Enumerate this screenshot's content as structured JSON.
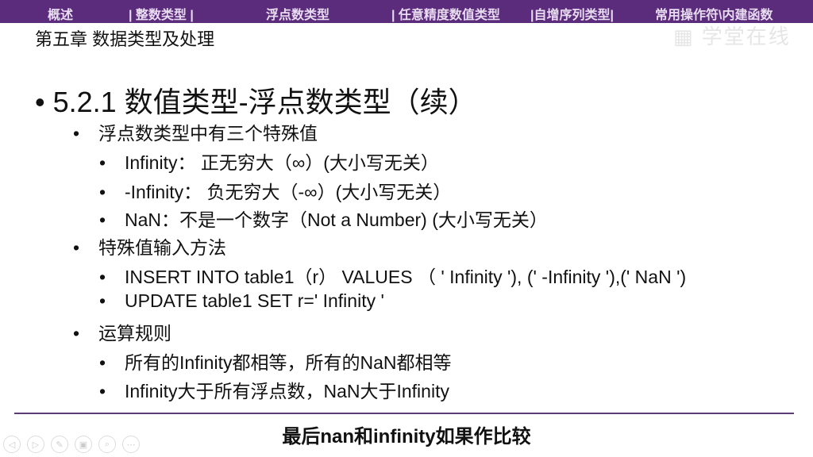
{
  "nav": [
    "概述",
    "| 整数类型 |",
    "浮点数类型",
    "| 任意精度数值类型",
    "|自增序列类型|",
    "常用操作符\\内建函数"
  ],
  "chapter": "第五章 数据类型及处理",
  "watermark": "学堂在线",
  "title": "5.2.1 数值类型-浮点数类型（续）",
  "bullets": [
    {
      "text": "浮点数类型中有三个特殊值",
      "subs": [
        "Infinity：  正无穷大（∞）(大小写无关）",
        "-Infinity：  负无穷大（-∞）(大小写无关）",
        "NaN：不是一个数字（Not a Number) (大小写无关）"
      ]
    },
    {
      "text": "特殊值输入方法",
      "subs": [
        "INSERT INTO table1（r） VALUES （ ' Infinity '), (' -Infinity '),(' NaN ')",
        "UPDATE table1 SET r=' Infinity '"
      ]
    },
    {
      "text": "运算规则",
      "subs": [
        "所有的Infinity都相等，所有的NaN都相等",
        "Infinity大于所有浮点数，NaN大于Infinity"
      ]
    }
  ],
  "caption": "最后nan和infinity如果作比较",
  "controls": [
    "prev-icon",
    "next-icon",
    "pen-icon",
    "slides-icon",
    "zoom-icon",
    "more-icon"
  ]
}
